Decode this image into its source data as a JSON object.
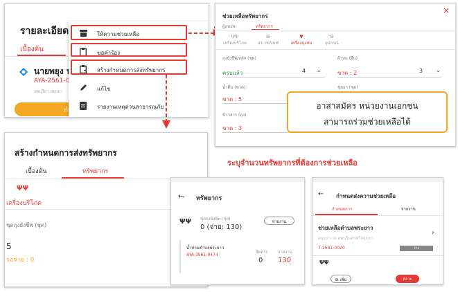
{
  "panel_a": {
    "title": "รายละเอียด",
    "tab": "เบื้องต้น",
    "name": "นายพยุง ห",
    "code": "AYA-2561-0",
    "sub": "ลพบุรีธา อยุธยา",
    "button": "กำลั",
    "menu": [
      {
        "label": "ให้ความช่วยเหลือ",
        "icon": "inbox-icon"
      },
      {
        "label": "ขอคำร้อง",
        "icon": "clipboard-icon"
      },
      {
        "label": "สร้างกำหนดการส่งทรัพยากร",
        "icon": "clipboard-add-icon"
      },
      {
        "label": "แก้ไข",
        "icon": "pencil-icon"
      },
      {
        "label": "รายงานเหตุด่วนสาธารณภัย",
        "icon": "report-icon"
      }
    ]
  },
  "panel_b": {
    "title": "ช่วยเหลือทรัพยากร",
    "tabs": [
      "ผู้อพยพ",
      "ทรัพยากร"
    ],
    "subtabs": [
      "เครื่องบริโภค",
      "ยาเวชภัณฑ์",
      "เครื่องนุ่งห่ม",
      "อุปกรณ์"
    ],
    "row1_left_label": "ถุงยังชีพ/หลัก (ชุด)",
    "row1_left_value": "ครบแล้ว",
    "row1_left_num": "4",
    "row1_right_label": "ผ้าห่ม (ผืน)",
    "row1_right_value": "ขาด : 2",
    "row1_right_num": "3",
    "row2_left_label": "น้ำดื่ม (ขวด)",
    "row2_left_value": "ขาด : 5",
    "row2_right_label": "ชุดยา (ชุด)",
    "row3_left_label": "ข้าวสาร (ถุง)",
    "row3_left_value": "ขาด : 3"
  },
  "callout": {
    "line1": "อาสาสมัคร หน่วยงานเอกชน",
    "line2": "สามารถร่วมช่วยเหลือได้"
  },
  "caption": "ระบุจำนวนทรัพยากรที่ต้องการช่วยเหลือ",
  "panel_c": {
    "title": "สร้างกำหนดการส่งทรัพยากร",
    "tabs": [
      "เบื้องต้น",
      "ทรัพยากร"
    ],
    "category": "เครื่องบริโภค",
    "field_label": "ชุดถุงยังชีพ (ชุด)",
    "value": "5",
    "pending": "รอจ่าย : 0"
  },
  "panel_d": {
    "title": "ทรัพยากร",
    "item_label": "ชุดถุงยังชีพ (ชุด)",
    "item_value": "0 (จ่าย: 130)",
    "pill": "จ่ายงาน",
    "sub_title": "น้ำท่วมตำบลพระยาว",
    "sub_code": "AYA-2561-0474",
    "col1_label": "จัดสรร",
    "col2_label": "จ่ายงาน",
    "col1_value": "0",
    "col2_value": "130"
  },
  "panel_e": {
    "title": "กำหนดส่งความช่วยเหลือ",
    "tabs": [
      "กำหนดการ",
      "จ่ายงาน"
    ],
    "item_title": "ช่วยเหลือตำบลพระยาว",
    "item_sub": "อยุธยาเวย ลพบุรีนครศรีอยุธยา",
    "item_code": "7-2561-0020",
    "badge": "ร่าง",
    "add_label": "เพิ่ม",
    "send_label": "ส่ง"
  },
  "colors": {
    "accent": "#e53935",
    "orange": "#f5a623",
    "green": "#2e9e44"
  }
}
